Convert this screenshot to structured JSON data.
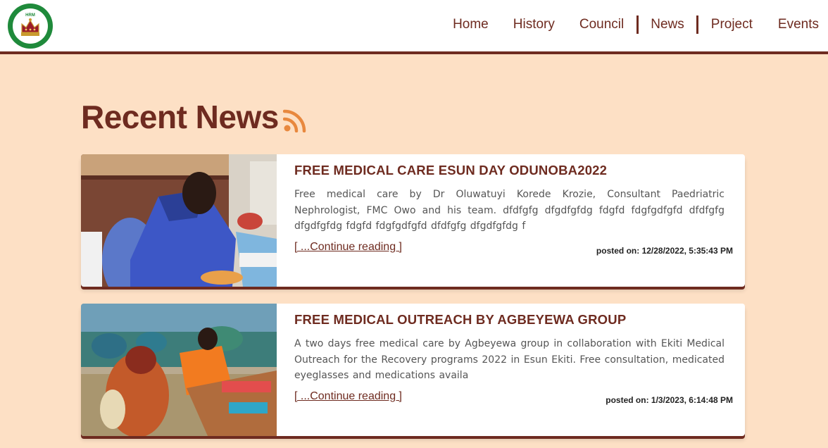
{
  "brand": {
    "logo_top_text": "HRM",
    "logo_ring_text": "ELEGBOR OF ESUN EKITI, EKITI EKITI"
  },
  "nav": {
    "items": [
      "Home",
      "History",
      "Council",
      "News",
      "Project",
      "Events"
    ]
  },
  "page": {
    "title": "Recent News"
  },
  "news": [
    {
      "title": "FREE MEDICAL CARE ESUN DAY ODUNOBA2022",
      "excerpt": "Free medical care by Dr Oluwatuyi Korede Krozie, Consultant Paedriatric Nephrologist, FMC Owo and his team. dfdfgfg dfgdfgfdg fdgfd fdgfgdfgfd dfdfgfg dfgdfgfdg fdgfd fdgfgdfgfd dfdfgfg dfgdfgfdg f",
      "read_more": "[ ...Continue reading ]",
      "posted": "posted on: 12/28/2022, 5:35:43 PM"
    },
    {
      "title": "FREE MEDICAL OUTREACH BY AGBEYEWA GROUP",
      "excerpt": "A two days free medical care by Agbeyewa group in collaboration with Ekiti Medical Outreach for the Recovery programs 2022 in Esun Ekiti. Free consultation, medicated eyeglasses and medications availa",
      "read_more": "[ ...Continue reading ]",
      "posted": "posted on: 1/3/2023, 6:14:48 PM"
    }
  ],
  "colors": {
    "brand": "#6e2b20",
    "background": "#fde0c5",
    "rss": "#e8883e",
    "logo_ring": "#1f8a3b"
  }
}
